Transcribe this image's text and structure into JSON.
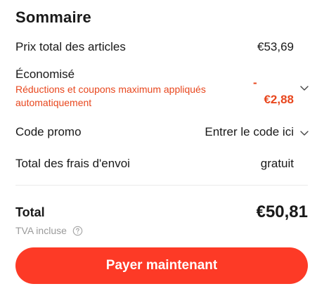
{
  "summary": {
    "title": "Sommaire",
    "items_total": {
      "label": "Prix total des articles",
      "value": "€53,69"
    },
    "savings": {
      "label": "Économisé",
      "note": "Réductions et coupons maximum appliqués automatiquement",
      "value_sign": "-",
      "value": "€2,88",
      "expand_icon": "chevron-down-icon"
    },
    "promo": {
      "label": "Code promo",
      "link": "Entrer le code ici",
      "expand_icon": "chevron-down-icon"
    },
    "shipping": {
      "label": "Total des frais d'envoi",
      "value": "gratuit"
    },
    "total": {
      "label": "Total",
      "value": "€50,81"
    },
    "vat": {
      "label": "TVA incluse",
      "help_icon": "question-circle-icon"
    },
    "pay_button": {
      "label": "Payer maintenant"
    }
  },
  "colors": {
    "accent": "#fd3a26",
    "savings": "#e8471e",
    "text": "#191919",
    "muted": "#9a9a9a"
  }
}
